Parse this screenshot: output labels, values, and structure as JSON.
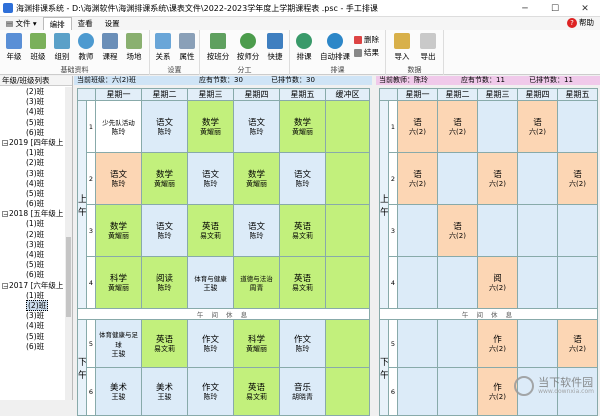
{
  "window": {
    "title": "海渊排课系统 - D:\\海渊软件\\海渊排课系统\\课表文件\\2022-2023学年度上学期课程表 .psc - 手工排课"
  },
  "menu": {
    "file": "文件",
    "tabs": [
      "编排",
      "查看",
      "设置"
    ],
    "help": "帮助"
  },
  "ribbon": {
    "groups": [
      {
        "label": "基础资料",
        "buttons": [
          "年级",
          "班级",
          "组别",
          "教师",
          "课程",
          "场地"
        ]
      },
      {
        "label": "设置",
        "buttons": [
          "关系",
          "属性"
        ]
      },
      {
        "label": "分工",
        "buttons": [
          "按班分",
          "按师分",
          "快捷"
        ]
      },
      {
        "label": "排课",
        "buttons": [
          "排课",
          "自动排课"
        ],
        "small": [
          "删除",
          "结果"
        ]
      },
      {
        "label": "数据",
        "buttons": [
          "导入",
          "导出"
        ]
      }
    ]
  },
  "tree": {
    "header": "年级/班级列表",
    "nodes": [
      {
        "label": "(2)班",
        "indent": 2
      },
      {
        "label": "(3)班",
        "indent": 2
      },
      {
        "label": "(4)班",
        "indent": 2
      },
      {
        "label": "(5)班",
        "indent": 2
      },
      {
        "label": "(6)班",
        "indent": 2
      },
      {
        "label": "2019 [四年级上",
        "indent": 1,
        "expander": "−"
      },
      {
        "label": "(1)班",
        "indent": 2
      },
      {
        "label": "(2)班",
        "indent": 2
      },
      {
        "label": "(3)班",
        "indent": 2
      },
      {
        "label": "(4)班",
        "indent": 2
      },
      {
        "label": "(5)班",
        "indent": 2
      },
      {
        "label": "(6)班",
        "indent": 2
      },
      {
        "label": "2018 [五年级上",
        "indent": 1,
        "expander": "−"
      },
      {
        "label": "(1)班",
        "indent": 2
      },
      {
        "label": "(2)班",
        "indent": 2
      },
      {
        "label": "(3)班",
        "indent": 2
      },
      {
        "label": "(4)班",
        "indent": 2
      },
      {
        "label": "(5)班",
        "indent": 2
      },
      {
        "label": "(6)班",
        "indent": 2
      },
      {
        "label": "2017 [六年级上",
        "indent": 1,
        "expander": "−"
      },
      {
        "label": "(1)班",
        "indent": 2
      },
      {
        "label": "(2)班",
        "indent": 2,
        "selected": true
      },
      {
        "label": "(3)班",
        "indent": 2
      },
      {
        "label": "(4)班",
        "indent": 2
      },
      {
        "label": "(5)班",
        "indent": 2
      },
      {
        "label": "(6)班",
        "indent": 2
      }
    ]
  },
  "class_info": {
    "current": "当前班级：六(2)班",
    "due": "应有节数：30",
    "scheduled": "已排节数：30"
  },
  "teacher_info": {
    "current": "当前教师：陈玲",
    "due": "应有节数：11",
    "scheduled": "已排节数：11"
  },
  "days": [
    "星期一",
    "星期二",
    "星期三",
    "星期四",
    "星期五"
  ],
  "buffer": "缓冲区",
  "morning": "上 午",
  "afternoon": "下 午",
  "noon_break": "午 间 休 息",
  "class_rows": [
    [
      {
        "s": "少先队活动",
        "t": "陈玲",
        "c": "w"
      },
      {
        "s": "语文",
        "t": "陈玲",
        "c": "b"
      },
      {
        "s": "数学",
        "t": "黄耀丽",
        "c": "g"
      },
      {
        "s": "语文",
        "t": "陈玲",
        "c": "b"
      },
      {
        "s": "数学",
        "t": "黄耀丽",
        "c": "g"
      }
    ],
    [
      {
        "s": "语文",
        "t": "陈玲",
        "c": "o"
      },
      {
        "s": "数学",
        "t": "黄耀丽",
        "c": "g"
      },
      {
        "s": "语文",
        "t": "陈玲",
        "c": "b"
      },
      {
        "s": "数学",
        "t": "黄耀丽",
        "c": "g"
      },
      {
        "s": "语文",
        "t": "陈玲",
        "c": "b"
      }
    ],
    [
      {
        "s": "数学",
        "t": "黄耀丽",
        "c": "g"
      },
      {
        "s": "语文",
        "t": "陈玲",
        "c": "b"
      },
      {
        "s": "英语",
        "t": "易文莉",
        "c": "g"
      },
      {
        "s": "语文",
        "t": "陈玲",
        "c": "b"
      },
      {
        "s": "英语",
        "t": "易文莉",
        "c": "g"
      }
    ],
    [
      {
        "s": "科学",
        "t": "黄耀丽",
        "c": "g"
      },
      {
        "s": "阅读",
        "t": "陈玲",
        "c": "g"
      },
      {
        "s": "体育与健康",
        "t": "王骏",
        "c": "b"
      },
      {
        "s": "道德与法治",
        "t": "周青",
        "c": "g"
      },
      {
        "s": "英语",
        "t": "易文莉",
        "c": "g"
      }
    ],
    [
      {
        "s": "体育健康与足球",
        "t": "王骏",
        "c": "b"
      },
      {
        "s": "英语",
        "t": "易文莉",
        "c": "g"
      },
      {
        "s": "作文",
        "t": "陈玲",
        "c": "b"
      },
      {
        "s": "科学",
        "t": "黄耀丽",
        "c": "g"
      },
      {
        "s": "作文",
        "t": "陈玲",
        "c": "b"
      }
    ],
    [
      {
        "s": "美术",
        "t": "王骏",
        "c": "b"
      },
      {
        "s": "美术",
        "t": "王骏",
        "c": "b"
      },
      {
        "s": "作文",
        "t": "陈玲",
        "c": "b"
      },
      {
        "s": "英语",
        "t": "易文莉",
        "c": "g"
      },
      {
        "s": "音乐",
        "t": "胡晓青",
        "c": "b"
      }
    ]
  ],
  "teacher_rows": [
    [
      "语|六(2)",
      "语|六(2)",
      "",
      "语|六(2)",
      ""
    ],
    [
      "语|六(2)",
      "",
      "语|六(2)",
      "",
      "语|六(2)"
    ],
    [
      "",
      "语|六(2)",
      "",
      "",
      ""
    ],
    [
      "",
      "",
      "阅|六(2)",
      "",
      ""
    ],
    [
      "",
      "",
      "作|六(2)",
      "",
      "语|六(2)"
    ],
    [
      "",
      "",
      "作|六(2)",
      "",
      ""
    ]
  ],
  "watermark": {
    "title": "当下软件园",
    "sub": "www.downxia.com"
  }
}
